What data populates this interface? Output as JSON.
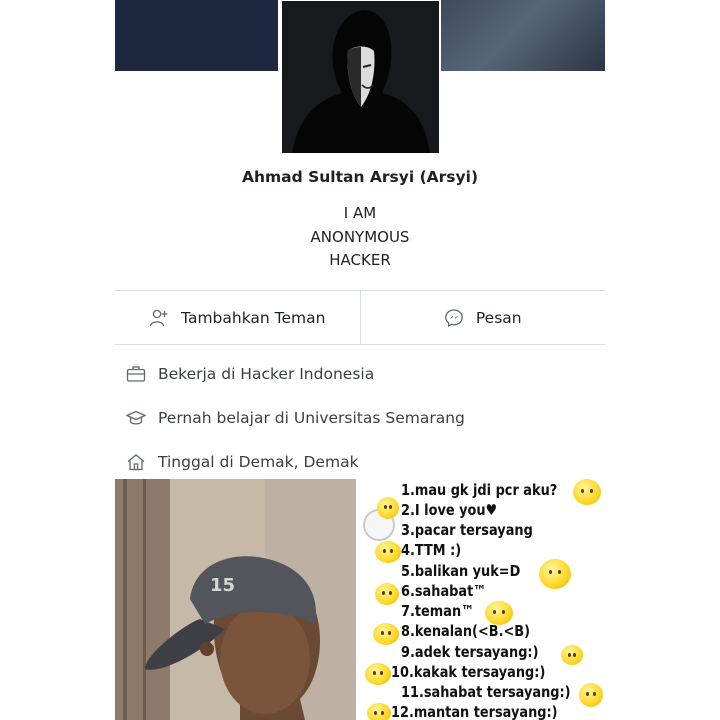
{
  "profile": {
    "name": "Ahmad Sultan Arsyi (Arsyi)",
    "bio": [
      "I AM",
      "ANONYMOUS",
      "HACKER"
    ]
  },
  "actions": {
    "add_friend": "Tambahkan Teman",
    "message": "Pesan"
  },
  "info": {
    "work": "Bekerja di Hacker Indonesia",
    "education": "Pernah belajar di Universitas Semarang",
    "lives": "Tinggal di Demak, Demak"
  },
  "meme": {
    "lines": [
      "1.mau gk jdi pcr aku?",
      "2.I love you♥",
      "3.pacar tersayang",
      "4.TTM :)",
      "5.balikan yuk=D",
      "6.sahabat™",
      "7.teman™",
      "8.kenalan(<B.<B)",
      "9.adek tersayang:)",
      "10.kakak tersayang:)",
      "11.sahabat tersayang:)",
      "12.mantan tersayang:)"
    ]
  },
  "icons": {
    "add_friend": "add-person-icon",
    "message": "messenger-icon",
    "work": "briefcase-icon",
    "education": "graduation-cap-icon",
    "lives": "home-icon"
  },
  "colors": {
    "cover_dark": "#1d2840",
    "divider": "#dadde1",
    "text": "#1d2129",
    "emoji": "#ffd92e"
  }
}
